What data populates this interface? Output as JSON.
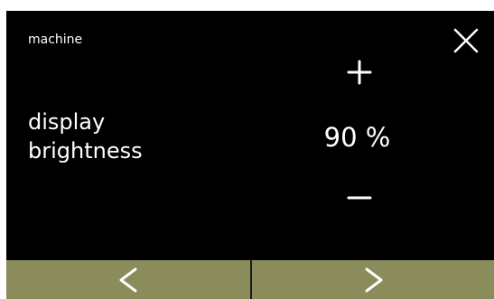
{
  "header": {
    "title": "machine"
  },
  "setting": {
    "label_line1": "display",
    "label_line2": "brightness",
    "value": "90 %",
    "level_percent": 90
  },
  "icons": {
    "close": "close-icon",
    "increase": "plus-icon",
    "decrease": "minus-icon",
    "previous": "chevron-left-icon",
    "next": "chevron-right-icon"
  },
  "colors": {
    "background": "#000000",
    "text": "#ffffff",
    "nav_bar": "#8a8c5c",
    "nav_divider": "#1a1a1a"
  }
}
